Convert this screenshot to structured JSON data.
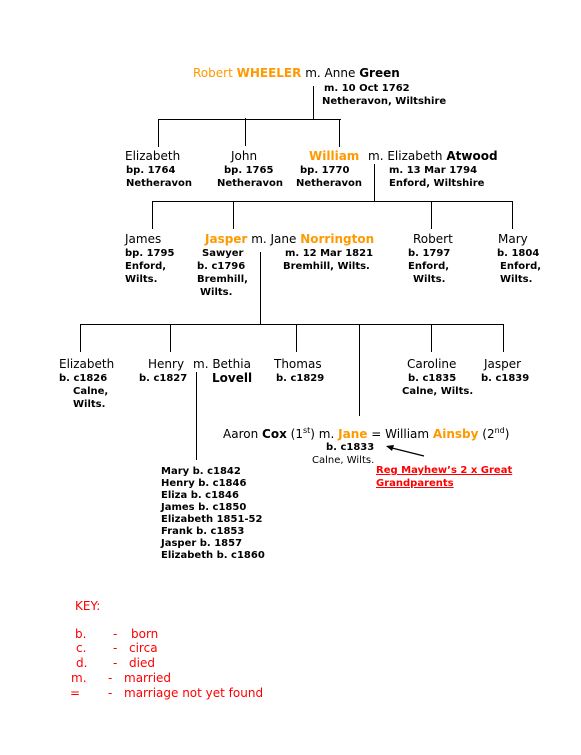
{
  "colors": {
    "highlight": "#FF9900",
    "key": "#FF0000",
    "lines": "#000000"
  },
  "gen1": {
    "husband_first": "Robert",
    "husband_surname": "WHEELER",
    "m": "m.",
    "wife_first": "Anne",
    "wife_surname": "Green",
    "marriage_date": "m. 10 Oct 1762",
    "marriage_place": "Netheravon, Wiltshire"
  },
  "gen2": {
    "children": [
      {
        "name": "Elizabeth",
        "line1": "bp. 1764",
        "line2": "Netheravon"
      },
      {
        "name": "John",
        "line1": "bp. 1765",
        "line2": "Netheravon"
      },
      {
        "name": "William",
        "line1": "bp. 1770",
        "line2": "Netheravon"
      }
    ],
    "spouse_prefix": "m. Elizabeth",
    "spouse_surname": "Atwood",
    "marriage_date": "m. 13 Mar 1794",
    "marriage_place": "Enford, Wiltshire"
  },
  "gen3": {
    "children": [
      {
        "name": "James",
        "lines": [
          "bp. 1795",
          "Enford,",
          "Wilts."
        ]
      },
      {
        "name": "Jasper",
        "lines": [
          "Sawyer",
          "b. c1796",
          "Bremhill,",
          "Wilts."
        ]
      },
      {
        "name": "Robert",
        "lines": [
          "b. 1797",
          "Enford,",
          "Wilts."
        ]
      },
      {
        "name": "Mary",
        "lines": [
          "b. 1804",
          "Enford,",
          "Wilts."
        ]
      }
    ],
    "spouse_prefix": "m. Jane",
    "spouse_surname": "Norrington",
    "marriage_date": "m. 12 Mar 1821",
    "marriage_place": "Bremhill, Wilts."
  },
  "gen4": {
    "children": [
      {
        "name": "Elizabeth",
        "lines": [
          "b. c1826",
          "Calne,",
          "Wilts."
        ]
      },
      {
        "name": "Henry",
        "lines": [
          "b. c1827"
        ]
      },
      {
        "name": "Thomas",
        "lines": [
          "b. c1829"
        ]
      },
      {
        "name": "Caroline",
        "lines": [
          "b. c1835",
          "Calne, Wilts."
        ]
      },
      {
        "name": "Jasper",
        "lines": [
          "b. c1839"
        ]
      }
    ],
    "henry_spouse_prefix": "m. Bethia",
    "henry_spouse_surname": "Lovell",
    "jane": {
      "first_husband_first": "Aaron",
      "first_husband_surname": "Cox",
      "first_ord": "1",
      "first_ord_sup": "st",
      "m": "m.",
      "name": "Jane",
      "eq": "=",
      "second_husband_first": "William",
      "second_husband_surname": "Ainsby",
      "second_ord": "2",
      "second_ord_sup": "nd",
      "born": "b. c1833",
      "place": "Calne, Wilts."
    },
    "annotation_link": [
      "Reg Mayhew’s 2 x Great",
      "Grandparents"
    ]
  },
  "gen5": {
    "children": [
      "Mary b. c1842",
      "Henry b. c1846",
      "Eliza b. c1846",
      "James b. c1850",
      "Elizabeth 1851-52",
      "Frank b. c1853",
      "Jasper b. 1857",
      "Elizabeth b. c1860"
    ]
  },
  "key": {
    "title": "KEY:",
    "entries": [
      {
        "abbr": "b.",
        "dash": "-",
        "meaning": "born"
      },
      {
        "abbr": "c.",
        "dash": "-",
        "meaning": "circa"
      },
      {
        "abbr": "d.",
        "dash": "-",
        "meaning": "died"
      },
      {
        "abbr": "m.",
        "dash": "-",
        "meaning": "married"
      },
      {
        "abbr": "=",
        "dash": "-",
        "meaning": "marriage not yet found"
      }
    ]
  }
}
